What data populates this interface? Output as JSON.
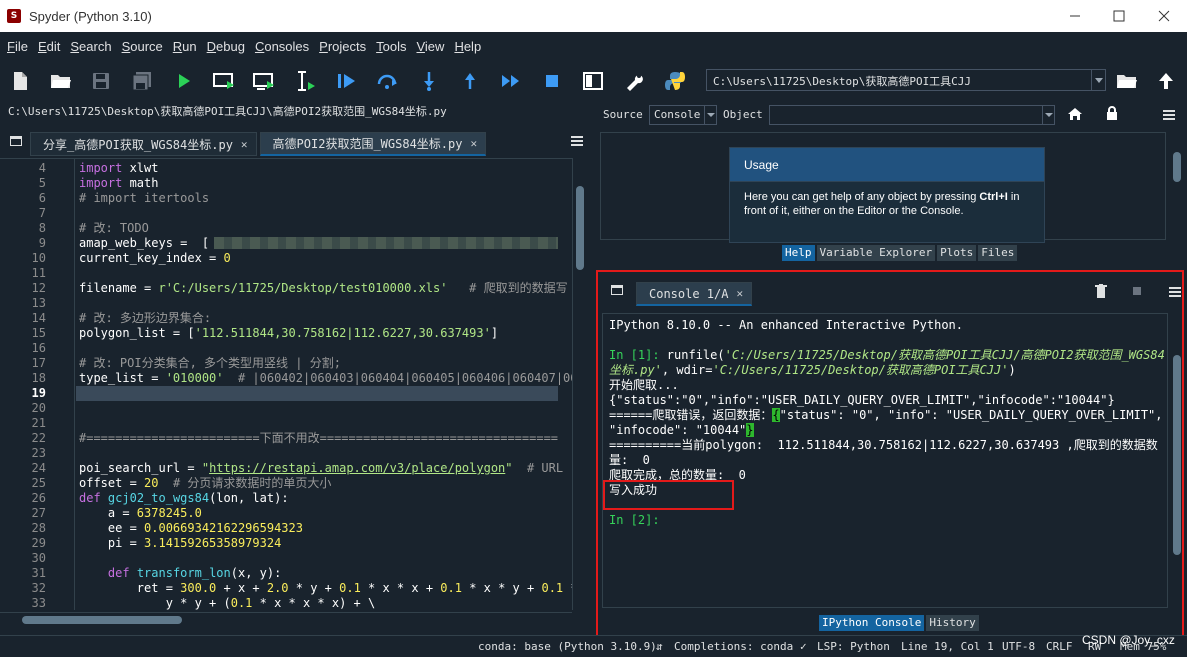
{
  "window": {
    "title": "Spyder (Python 3.10)",
    "app_icon": "S"
  },
  "menu": [
    {
      "label": "File",
      "key": "F",
      "rest": "ile"
    },
    {
      "label": "Edit",
      "key": "E",
      "rest": "dit"
    },
    {
      "label": "Search",
      "key": "S",
      "rest": "earch"
    },
    {
      "label": "Source",
      "key": "S",
      "rest": "ource"
    },
    {
      "label": "Run",
      "key": "R",
      "rest": "un"
    },
    {
      "label": "Debug",
      "key": "D",
      "rest": "ebug"
    },
    {
      "label": "Consoles",
      "key": "C",
      "rest": "onsoles"
    },
    {
      "label": "Projects",
      "key": "P",
      "rest": "rojects"
    },
    {
      "label": "Tools",
      "key": "T",
      "rest": "ools"
    },
    {
      "label": "View",
      "key": "V",
      "rest": "iew"
    },
    {
      "label": "Help",
      "key": "H",
      "rest": "elp"
    }
  ],
  "toolbar": {
    "working_dir": "C:\\Users\\11725\\Desktop\\获取高德POI工具CJJ",
    "icons": [
      "new-file-icon",
      "open-file-icon",
      "save-icon",
      "save-all-icon",
      "run-icon",
      "run-cell-icon",
      "run-cell-advance-icon",
      "run-selection-icon",
      "debug-icon",
      "step-over-icon",
      "step-into-icon",
      "step-return-icon",
      "continue-icon",
      "stop-debug-icon",
      "maximize-pane-icon",
      "preferences-icon",
      "python-path-icon"
    ]
  },
  "editor": {
    "file_path": "C:\\Users\\11725\\Desktop\\获取高德POI工具CJJ\\高德POI2获取范围_WGS84坐标.py",
    "tabs": [
      {
        "label": "分享_高德POI获取_WGS84坐标.py",
        "active": false
      },
      {
        "label": "高德POI2获取范围_WGS84坐标.py",
        "active": true
      }
    ],
    "current_line": 19,
    "lines": [
      {
        "n": "4",
        "code": "import xlwt"
      },
      {
        "n": "5",
        "code": "import math"
      },
      {
        "n": "6",
        "code": "# import itertools"
      },
      {
        "n": "7",
        "code": ""
      },
      {
        "n": "8",
        "code": "# 改: TODO"
      },
      {
        "n": "9",
        "code": "amap_web_keys =  ["
      },
      {
        "n": "10",
        "code": "current_key_index = 0"
      },
      {
        "n": "11",
        "code": ""
      },
      {
        "n": "12",
        "code": "filename = r'C:/Users/11725/Desktop/test010000.xls'   # 爬取到的数据写"
      },
      {
        "n": "13",
        "code": ""
      },
      {
        "n": "14",
        "code": "# 改: 多边形边界集合:"
      },
      {
        "n": "15",
        "code": "polygon_list = ['112.511844,30.758162|112.6227,30.637493']"
      },
      {
        "n": "16",
        "code": ""
      },
      {
        "n": "17",
        "code": "# 改: POI分类集合, 多个类型用竖线 | 分割;"
      },
      {
        "n": "18",
        "code": "type_list = '010000'  # |060402|060403|060404|060405|060406|060407|06"
      },
      {
        "n": "19",
        "code": ""
      },
      {
        "n": "20",
        "code": ""
      },
      {
        "n": "21",
        "code": ""
      },
      {
        "n": "22",
        "code": "#========================下面不用改================================="
      },
      {
        "n": "23",
        "code": ""
      },
      {
        "n": "24",
        "code": "poi_search_url = \"https://restapi.amap.com/v3/place/polygon\"  # URL"
      },
      {
        "n": "25",
        "code": "offset = 20  # 分页请求数据时的单页大小"
      },
      {
        "n": "26",
        "code": "def gcj02_to_wgs84(lon, lat):"
      },
      {
        "n": "27",
        "code": "    a = 6378245.0"
      },
      {
        "n": "28",
        "code": "    ee = 0.00669342162296594323"
      },
      {
        "n": "29",
        "code": "    pi = 3.14159265358979324"
      },
      {
        "n": "30",
        "code": ""
      },
      {
        "n": "31",
        "code": "    def transform_lon(x, y):"
      },
      {
        "n": "32",
        "code": "        ret = 300.0 + x + 2.0 * y + 0.1 * x * x + 0.1 * x * y + 0.1 *"
      },
      {
        "n": "33",
        "code": "            y * y + (0.1 * x * x * x) + \\"
      }
    ]
  },
  "help": {
    "source_label": "Source",
    "source_value": "Console",
    "object_label": "Object",
    "object_value": "",
    "usage_title": "Usage",
    "usage_text_1": "Here you can get help of any object by pressing ",
    "usage_shortcut": "Ctrl+I",
    "usage_text_2": " in front of it, either on the Editor or the Console.",
    "tabs": [
      "Help",
      "Variable Explorer",
      "Plots",
      "Files"
    ]
  },
  "console": {
    "tab_label": "Console 1/A",
    "lines": {
      "banner": "IPython 8.10.0 -- An enhanced Interactive Python.",
      "in1_prompt": "In [1]: ",
      "in1_call": "runfile(",
      "in1_arg1a": "'C:/Users/11725/Desktop/获取高德POI工具CJJ/高德POI2获取范围_WGS84",
      "in1_arg1b": "坐标.py'",
      "in1_mid": ", wdir=",
      "in1_arg2": "'C:/Users/11725/Desktop/获取高德POI工具CJJ'",
      "in1_end": ")",
      "start": "开始爬取...",
      "json1": "{\"status\":\"0\",\"info\":\"USER_DAILY_QUERY_OVER_LIMIT\",\"infocode\":\"10044\"}",
      "err_prefix": "======爬取错误，返回数据：",
      "err_brace": "{",
      "err_rest": "\"status\": \"0\", \"info\": \"USER_DAILY_QUERY_OVER_LIMIT\",",
      "err_line2": "\"infocode\": \"10044\"",
      "err_close": "}",
      "polygon": "==========当前polygon:  112.511844,30.758162|112.6227,30.637493 ,爬取到的数据数",
      "qty": "量:  0",
      "done": "爬取完成，总的数量:  0",
      "written": "写入成功",
      "in2_prompt": "In [2]:"
    },
    "tabs": [
      "IPython Console",
      "History"
    ]
  },
  "status": {
    "conda": "conda: base (Python 3.10.9)",
    "completions": "Completions: conda",
    "lsp": "LSP: Python",
    "cursor": "Line 19, Col 1",
    "encoding": "UTF-8",
    "eol": "CRLF",
    "rw": "RW",
    "mem": "Mem 75%",
    "watermark": "CSDN @Joy_cxz"
  }
}
